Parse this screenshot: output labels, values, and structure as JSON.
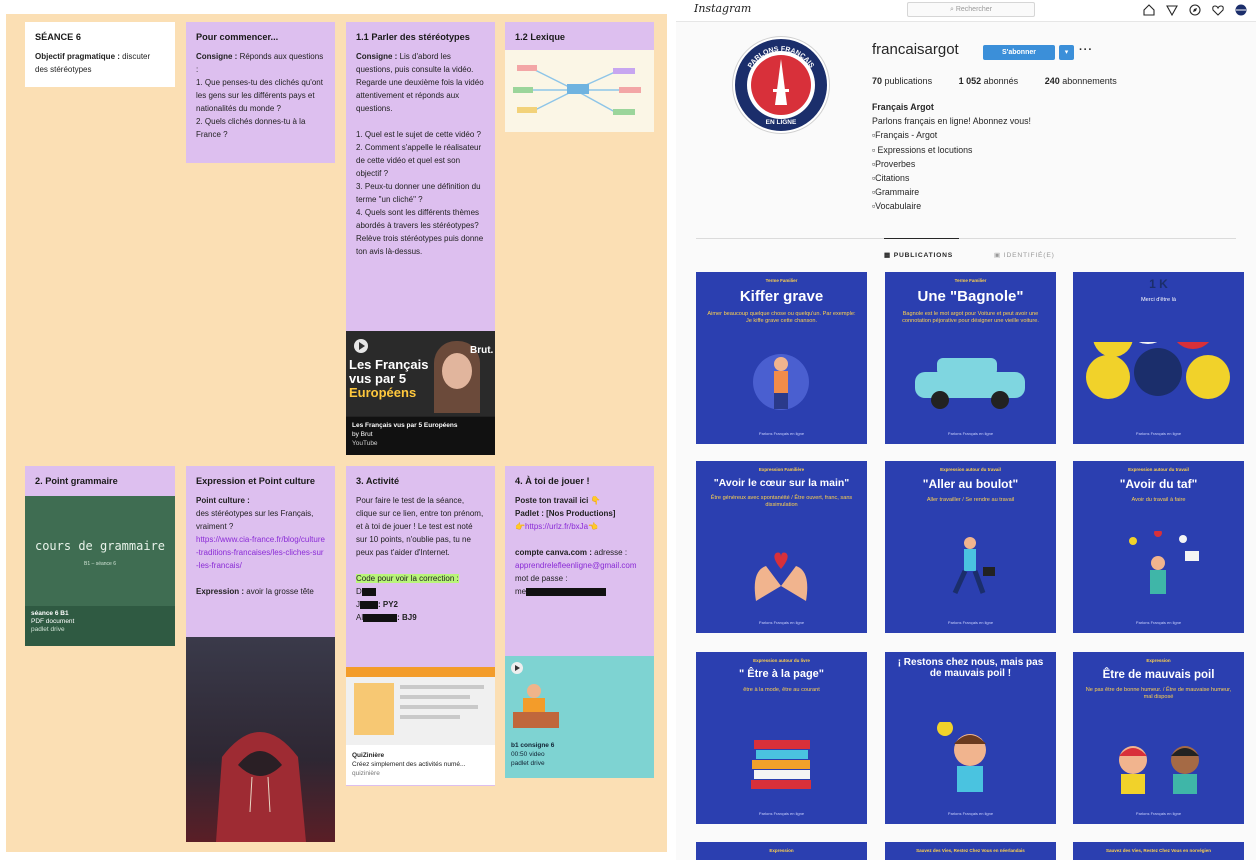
{
  "padlet": {
    "seance_card": {
      "title": "SÉANCE 6",
      "objective_label": "Objectif pragmatique :",
      "objective_text": "discuter des stéréotypes"
    },
    "commencer_card": {
      "title": "Pour commencer...",
      "consigne_label": "Consigne :",
      "consigne_text": "Réponds aux questions :",
      "q1": "1. Que penses-tu des clichés qu'ont les gens sur les différents pays et nationalités du monde ?",
      "q2": "2. Quels clichés donnes-tu à la France ?"
    },
    "stereotypes_card": {
      "title": "1.1 Parler des stéréotypes",
      "consigne_label": "Consigne :",
      "consigne_text": "Lis d'abord les questions, puis consulte la vidéo. Regarde une deuxième fois la vidéo attentivement et réponds aux questions.",
      "q1": "1. Quel est le sujet de cette vidéo ?",
      "q2": "2. Comment s'appelle le réalisateur de cette vidéo et quel est son objectif ?",
      "q3": "3. Peux-tu donner une définition du terme \"un cliché\" ?",
      "q4": "4. Quels sont les différents thèmes abordés à travers les stéréotypes? Relève trois stéréotypes puis donne ton avis là-dessus.",
      "video_overlay_line1": "Les Français",
      "video_overlay_line2": "vus par 5",
      "video_overlay_line3": "Européens",
      "video_brand": "Brut.",
      "video_title": "Les Français vus par 5 Européens",
      "video_author": "by Brut",
      "video_source": "YouTube"
    },
    "lexique_card": {
      "title": "1.2 Lexique"
    },
    "grammaire_card": {
      "title": "2. Point grammaire",
      "board_text": "cours de grammaire",
      "board_sub": "B1 – séance 6",
      "file_name": "séance 6 B1",
      "file_type": "PDF document",
      "file_source": "padlet drive"
    },
    "culture_card": {
      "title": "Expression et Point culture",
      "culture_label": "Point culture :",
      "culture_text": "des stéréotypes sur les Français, vraiment ?",
      "culture_link": "https://www.cia-france.fr/blog/culture-traditions-francaises/les-cliches-sur-les-francais/",
      "expression_label": "Expression :",
      "expression_text": "avoir la grosse tête"
    },
    "activite_card": {
      "title": "3. Activité",
      "text": "Pour faire le test de la séance, clique sur ce lien, entre ton prénom, et à toi de jouer ! Le test est noté sur 10 points, n'oublie pas, tu ne peux pas t'aider d'Internet.",
      "code_label": "Code pour voir la correction :",
      "code1_prefix": "D",
      "code2_prefix": "J",
      "code2_suffix": ": PY2",
      "code3_prefix": "Al",
      "code3_suffix": ": BJ9",
      "quiz_title": "QuiZinière",
      "quiz_desc": "Créez simplement des activités numé...",
      "quiz_source": "quizinière"
    },
    "jouer_card": {
      "title": "4. À toi de jouer !",
      "poste_label": "Poste ton travail ici",
      "poste_emoji": "👇",
      "padlet_label": "Padlet : [Nos Productions]",
      "padlet_link": "👉https://urlz.fr/bxJa👈",
      "canva_label": "compte canva.com :",
      "canva_text": "adresse :",
      "canva_email": "apprendrelefleenligne@gmail.com",
      "password_label": "mot de passe :",
      "password_prefix": "me",
      "video_title": "b1 consigne 6",
      "video_duration": "00:50 video",
      "video_source": "padlet drive"
    }
  },
  "instagram": {
    "logo": "Instagram",
    "search_placeholder": "Rechercher",
    "username": "francaisargot",
    "follow_label": "S'abonner",
    "more": "···",
    "avatar_ring_text": "PARLONS FRANÇAIS",
    "avatar_bottom_text": "EN LIGNE",
    "stats": {
      "publications_count": "70",
      "publications_label": "publications",
      "followers_count": "1 052",
      "followers_label": "abonnés",
      "following_count": "240",
      "following_label": "abonnements"
    },
    "bio": {
      "name": "Français Argot",
      "line1": "Parlons français en ligne! Abonnez vous!",
      "line2": "▫Français - Argot",
      "line3": "▫ Expressions et locutions",
      "line4": "▫Proverbes",
      "line5": "▫Citations",
      "line6": "▫Grammaire",
      "line7": "▫Vocabulaire"
    },
    "tabs": {
      "publications": "PUBLICATIONS",
      "identifie": "IDENTIFIÉ(E)"
    },
    "posts": [
      {
        "kicker": "Terme Familier",
        "big": "Kiffer grave",
        "sub": "Aimer beaucoup quelque chose ou quelqu'un. Par exemple: Je kiffe grave cette chanson."
      },
      {
        "kicker": "Terme Familier",
        "big": "Une \"Bagnole\"",
        "sub": "Bagnole est le mot argot pour Voiture et peut avoir une connotation péjorative pour désigner une vieille voiture."
      },
      {
        "kicker": "",
        "big": "1 K",
        "sub": "Merci d'être là"
      },
      {
        "kicker": "Expression Familière",
        "big": "\"Avoir le cœur sur la main\"",
        "sub": "Être généreux avec spontanéité / Être ouvert, franc, sans dissimulation"
      },
      {
        "kicker": "Expression autour du travail",
        "big": "\"Aller au boulot\"",
        "sub": "Aller travailler / Se rendre au travail"
      },
      {
        "kicker": "Expression autour du travail",
        "big": "\"Avoir du taf\"",
        "sub": "Avoir du travail à faire"
      },
      {
        "kicker": "Expression autour du livre",
        "big": "\" Être à la page\"",
        "sub": "être à la mode, être au courant"
      },
      {
        "kicker": "",
        "big": "¡ Restons chez nous, mais pas de mauvais poil !",
        "sub": ""
      },
      {
        "kicker": "Expression",
        "big": "Être de mauvais poil",
        "sub": "Ne pas être de bonne humeur. / Être de mauvaise humeur, mal disposé"
      },
      {
        "kicker": "Expression",
        "big": "",
        "sub": ""
      },
      {
        "kicker": "Sauvez des Vies, Restez Chez Vous en néerlandais",
        "big": "",
        "sub": ""
      },
      {
        "kicker": "Sauvez des Vies, Restez Chez Vous en norvégien",
        "big": "",
        "sub": ""
      }
    ],
    "post_brand": "Parlons Français en ligne"
  }
}
